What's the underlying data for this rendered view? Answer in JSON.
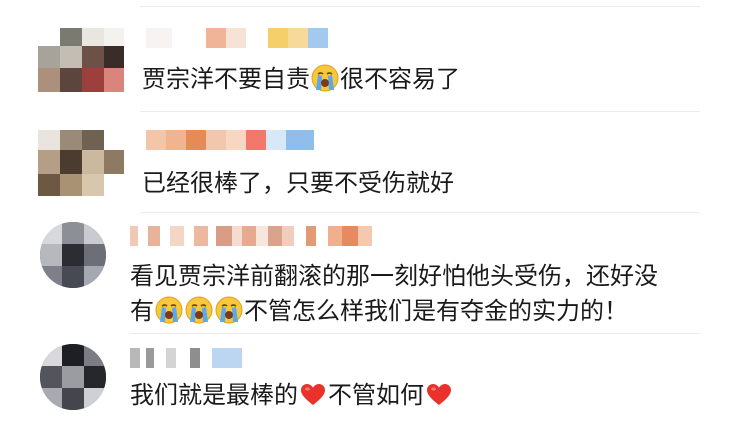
{
  "comments": [
    {
      "id": "c1",
      "segments": [
        {
          "type": "text",
          "value": "贾宗洋不要自责"
        },
        {
          "type": "emoji",
          "icon": "loudly-crying-face-icon"
        },
        {
          "type": "text",
          "value": "很不容易了"
        }
      ]
    },
    {
      "id": "c2",
      "segments": [
        {
          "type": "text",
          "value": "已经很棒了，只要不受伤就好"
        }
      ]
    },
    {
      "id": "c3",
      "line1": "看见贾宗洋前翻滚的那一刻好怕他头受伤，还好没",
      "line2_prefix": "有",
      "line2_suffix": "不管怎么样我们是有夺金的实力的！",
      "emoji_icon": "loudly-crying-face-icon",
      "emoji_count": 3
    },
    {
      "id": "c4",
      "part1": "我们就是最棒的",
      "part2": "不管如何",
      "emoji_icon": "red-heart-icon"
    }
  ],
  "colors": {
    "text": "#1a1a1a",
    "divider": "#ececec",
    "heart": "#e8322b",
    "emoji_face": "#f8c73b",
    "emoji_tear": "#5aa9e8"
  }
}
